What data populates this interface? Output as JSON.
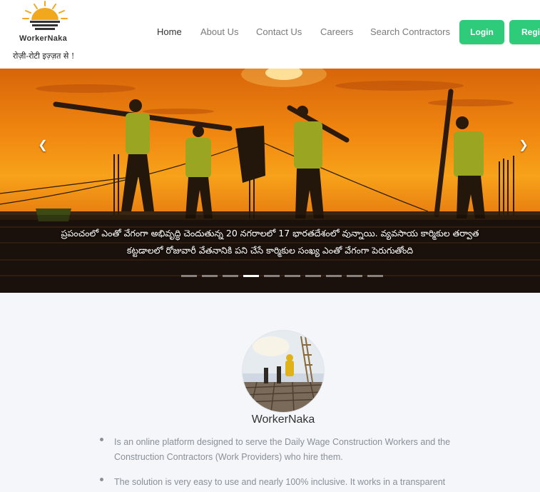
{
  "brand": {
    "name": "WorkerNaka",
    "tagline": "रोज़ी-रोटी इज़्ज़त से !"
  },
  "nav": {
    "items": [
      "Home",
      "About Us",
      "Contact Us",
      "Careers",
      "Search Contractors"
    ],
    "active": "Home",
    "login_label": "Login",
    "register_label": "Regis"
  },
  "hero": {
    "caption": "ప్రపంచంలో ఎంతో వేగంగా అభివృద్ధి చెందుతున్న 20 నగరాలలో 17 భారతదేశంలో వున్నాయి. వ్యవసాయ కార్మికుల తర్వాత కట్టడాలలో రోజువారీ వేతనానికి పని చేసే కార్మికుల సంఖ్య ఎంతో వేగంగా పెరుగుతోంది",
    "prev_icon": "chevron-left-icon",
    "next_icon": "chevron-right-icon",
    "slide_count": 10,
    "active_slide": 4
  },
  "about": {
    "title": "WorkerNaka",
    "points": [
      "Is an online platform designed to serve the Daily Wage Construction Workers and the Construction Contractors (Work Providers) who hire them.",
      "The solution is very easy to use and nearly 100% inclusive. It works in a transparent"
    ]
  },
  "colors": {
    "accent": "#2ecc7a",
    "text_muted": "#8a8f98",
    "background": "#f4f6fa"
  }
}
